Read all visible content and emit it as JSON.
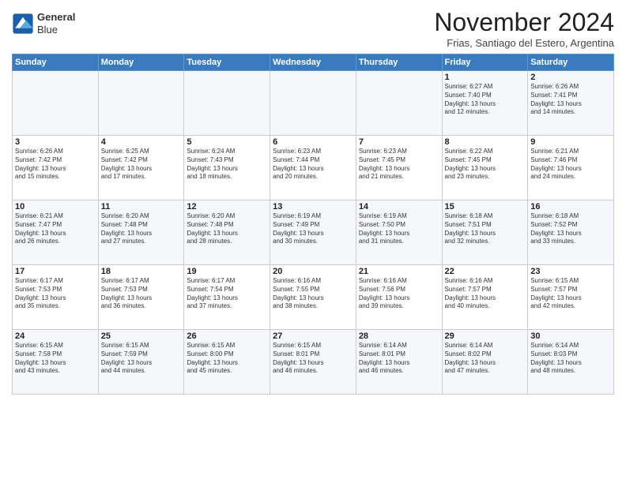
{
  "header": {
    "logo_line1": "General",
    "logo_line2": "Blue",
    "month": "November 2024",
    "location": "Frias, Santiago del Estero, Argentina"
  },
  "weekdays": [
    "Sunday",
    "Monday",
    "Tuesday",
    "Wednesday",
    "Thursday",
    "Friday",
    "Saturday"
  ],
  "weeks": [
    [
      {
        "day": "",
        "info": ""
      },
      {
        "day": "",
        "info": ""
      },
      {
        "day": "",
        "info": ""
      },
      {
        "day": "",
        "info": ""
      },
      {
        "day": "",
        "info": ""
      },
      {
        "day": "1",
        "info": "Sunrise: 6:27 AM\nSunset: 7:40 PM\nDaylight: 13 hours\nand 12 minutes."
      },
      {
        "day": "2",
        "info": "Sunrise: 6:26 AM\nSunset: 7:41 PM\nDaylight: 13 hours\nand 14 minutes."
      }
    ],
    [
      {
        "day": "3",
        "info": "Sunrise: 6:26 AM\nSunset: 7:42 PM\nDaylight: 13 hours\nand 15 minutes."
      },
      {
        "day": "4",
        "info": "Sunrise: 6:25 AM\nSunset: 7:42 PM\nDaylight: 13 hours\nand 17 minutes."
      },
      {
        "day": "5",
        "info": "Sunrise: 6:24 AM\nSunset: 7:43 PM\nDaylight: 13 hours\nand 18 minutes."
      },
      {
        "day": "6",
        "info": "Sunrise: 6:23 AM\nSunset: 7:44 PM\nDaylight: 13 hours\nand 20 minutes."
      },
      {
        "day": "7",
        "info": "Sunrise: 6:23 AM\nSunset: 7:45 PM\nDaylight: 13 hours\nand 21 minutes."
      },
      {
        "day": "8",
        "info": "Sunrise: 6:22 AM\nSunset: 7:45 PM\nDaylight: 13 hours\nand 23 minutes."
      },
      {
        "day": "9",
        "info": "Sunrise: 6:21 AM\nSunset: 7:46 PM\nDaylight: 13 hours\nand 24 minutes."
      }
    ],
    [
      {
        "day": "10",
        "info": "Sunrise: 6:21 AM\nSunset: 7:47 PM\nDaylight: 13 hours\nand 26 minutes."
      },
      {
        "day": "11",
        "info": "Sunrise: 6:20 AM\nSunset: 7:48 PM\nDaylight: 13 hours\nand 27 minutes."
      },
      {
        "day": "12",
        "info": "Sunrise: 6:20 AM\nSunset: 7:48 PM\nDaylight: 13 hours\nand 28 minutes."
      },
      {
        "day": "13",
        "info": "Sunrise: 6:19 AM\nSunset: 7:49 PM\nDaylight: 13 hours\nand 30 minutes."
      },
      {
        "day": "14",
        "info": "Sunrise: 6:19 AM\nSunset: 7:50 PM\nDaylight: 13 hours\nand 31 minutes."
      },
      {
        "day": "15",
        "info": "Sunrise: 6:18 AM\nSunset: 7:51 PM\nDaylight: 13 hours\nand 32 minutes."
      },
      {
        "day": "16",
        "info": "Sunrise: 6:18 AM\nSunset: 7:52 PM\nDaylight: 13 hours\nand 33 minutes."
      }
    ],
    [
      {
        "day": "17",
        "info": "Sunrise: 6:17 AM\nSunset: 7:53 PM\nDaylight: 13 hours\nand 35 minutes."
      },
      {
        "day": "18",
        "info": "Sunrise: 6:17 AM\nSunset: 7:53 PM\nDaylight: 13 hours\nand 36 minutes."
      },
      {
        "day": "19",
        "info": "Sunrise: 6:17 AM\nSunset: 7:54 PM\nDaylight: 13 hours\nand 37 minutes."
      },
      {
        "day": "20",
        "info": "Sunrise: 6:16 AM\nSunset: 7:55 PM\nDaylight: 13 hours\nand 38 minutes."
      },
      {
        "day": "21",
        "info": "Sunrise: 6:16 AM\nSunset: 7:56 PM\nDaylight: 13 hours\nand 39 minutes."
      },
      {
        "day": "22",
        "info": "Sunrise: 6:16 AM\nSunset: 7:57 PM\nDaylight: 13 hours\nand 40 minutes."
      },
      {
        "day": "23",
        "info": "Sunrise: 6:15 AM\nSunset: 7:57 PM\nDaylight: 13 hours\nand 42 minutes."
      }
    ],
    [
      {
        "day": "24",
        "info": "Sunrise: 6:15 AM\nSunset: 7:58 PM\nDaylight: 13 hours\nand 43 minutes."
      },
      {
        "day": "25",
        "info": "Sunrise: 6:15 AM\nSunset: 7:59 PM\nDaylight: 13 hours\nand 44 minutes."
      },
      {
        "day": "26",
        "info": "Sunrise: 6:15 AM\nSunset: 8:00 PM\nDaylight: 13 hours\nand 45 minutes."
      },
      {
        "day": "27",
        "info": "Sunrise: 6:15 AM\nSunset: 8:01 PM\nDaylight: 13 hours\nand 46 minutes."
      },
      {
        "day": "28",
        "info": "Sunrise: 6:14 AM\nSunset: 8:01 PM\nDaylight: 13 hours\nand 46 minutes."
      },
      {
        "day": "29",
        "info": "Sunrise: 6:14 AM\nSunset: 8:02 PM\nDaylight: 13 hours\nand 47 minutes."
      },
      {
        "day": "30",
        "info": "Sunrise: 6:14 AM\nSunset: 8:03 PM\nDaylight: 13 hours\nand 48 minutes."
      }
    ]
  ]
}
